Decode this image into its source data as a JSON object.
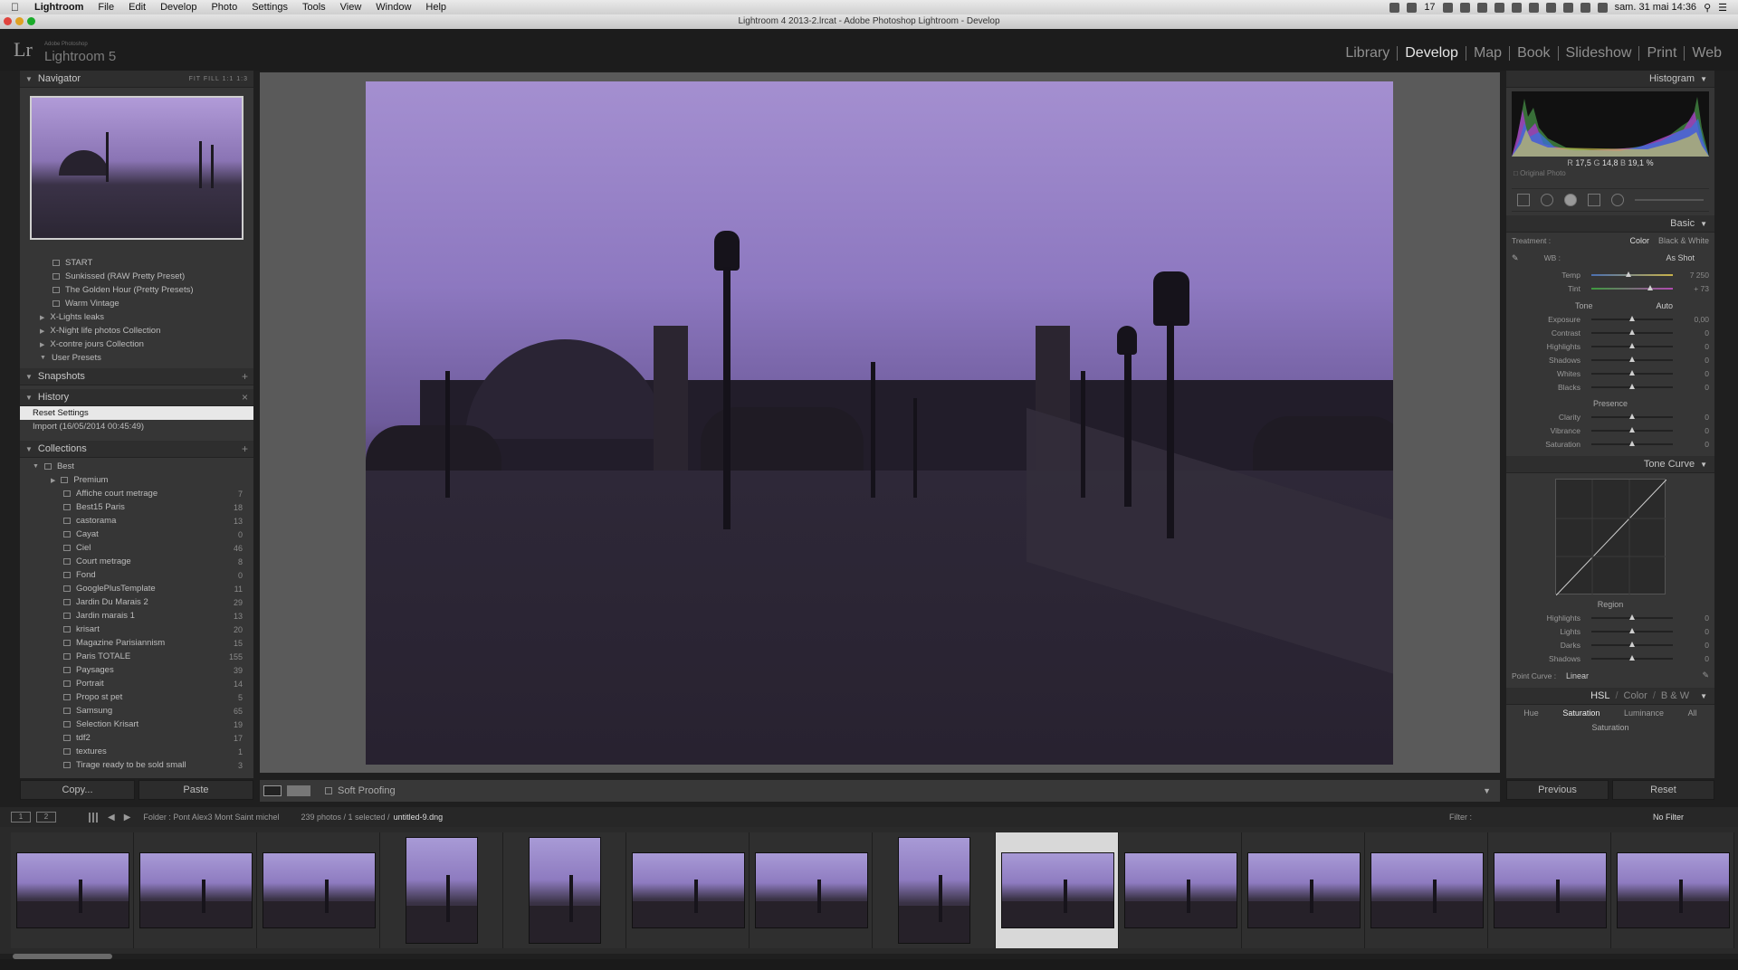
{
  "menubar": {
    "app": "Lightroom",
    "items": [
      "File",
      "Edit",
      "Develop",
      "Photo",
      "Settings",
      "Tools",
      "View",
      "Window",
      "Help"
    ],
    "status": "17",
    "clock": "sam. 31 mai  14:36"
  },
  "window": {
    "title": "Lightroom 4 2013-2.lrcat - Adobe Photoshop Lightroom - Develop"
  },
  "identity": {
    "brand": "Adobe Photoshop",
    "product": "Lightroom 5"
  },
  "modules": [
    "Library",
    "Develop",
    "Map",
    "Book",
    "Slideshow",
    "Print",
    "Web"
  ],
  "left": {
    "navigator": {
      "title": "Navigator",
      "opts": "FIT  FILL  1:1  1:3"
    },
    "presets": [
      {
        "label": "START",
        "indent": 2
      },
      {
        "label": "Sunkissed (RAW Pretty Preset)",
        "indent": 2
      },
      {
        "label": "The Golden Hour (Pretty Presets)",
        "indent": 2
      },
      {
        "label": "Warm Vintage",
        "indent": 2
      },
      {
        "label": "X-Lights leaks",
        "indent": 1
      },
      {
        "label": "X-Night life  photos Collection",
        "indent": 1
      },
      {
        "label": "X-contre jours Collection",
        "indent": 1
      },
      {
        "label": "User Presets",
        "indent": 1
      }
    ],
    "snapshots": {
      "title": "Snapshots"
    },
    "history": {
      "title": "History",
      "items": [
        "Reset Settings",
        "Import (16/05/2014 00:45:49)"
      ]
    },
    "collections": {
      "title": "Collections",
      "root": "Best",
      "items": [
        {
          "label": "Premium",
          "count": ""
        },
        {
          "label": "Affiche court metrage",
          "count": "7"
        },
        {
          "label": "Best15 Paris",
          "count": "18"
        },
        {
          "label": "castorama",
          "count": "13"
        },
        {
          "label": "Cayat",
          "count": "0"
        },
        {
          "label": "Ciel",
          "count": "46"
        },
        {
          "label": "Court metrage",
          "count": "8"
        },
        {
          "label": "Fond",
          "count": "0"
        },
        {
          "label": "GooglePlusTemplate",
          "count": "11"
        },
        {
          "label": "Jardin Du Marais 2",
          "count": "29"
        },
        {
          "label": "Jardin marais 1",
          "count": "13"
        },
        {
          "label": "krisart",
          "count": "20"
        },
        {
          "label": "Magazine Parisiannism",
          "count": "15"
        },
        {
          "label": "Paris TOTALE",
          "count": "155"
        },
        {
          "label": "Paysages",
          "count": "39"
        },
        {
          "label": "Portrait",
          "count": "14"
        },
        {
          "label": "Propo st pet",
          "count": "5"
        },
        {
          "label": "Samsung",
          "count": "65"
        },
        {
          "label": "Selection Krisart",
          "count": "19"
        },
        {
          "label": "tdf2",
          "count": "17"
        },
        {
          "label": "textures",
          "count": "1"
        },
        {
          "label": "Tirage ready to be sold small",
          "count": "3"
        }
      ]
    },
    "buttons": {
      "copy": "Copy...",
      "paste": "Paste"
    }
  },
  "center": {
    "soft_proofing": "Soft Proofing"
  },
  "right": {
    "histogram": {
      "title": "Histogram",
      "r_label": "R",
      "r": "17,5",
      "g_label": "G",
      "g": "14,8",
      "b_label": "B",
      "b": "19,1",
      "pct": "%",
      "original": "Original Photo"
    },
    "basic": {
      "title": "Basic",
      "treatment_label": "Treatment :",
      "color": "Color",
      "bw": "Black & White",
      "wb_label": "WB :",
      "wb_value": "As Shot",
      "wb_sliders": [
        {
          "label": "Temp",
          "value": "7 250",
          "pos": 0.46
        },
        {
          "label": "Tint",
          "value": "+ 73",
          "pos": 0.72
        }
      ],
      "tone_label": "Tone",
      "auto": "Auto",
      "tone_sliders": [
        {
          "label": "Exposure",
          "value": "0,00",
          "pos": 0.5
        },
        {
          "label": "Contrast",
          "value": "0",
          "pos": 0.5
        },
        {
          "label": "Highlights",
          "value": "0",
          "pos": 0.5
        },
        {
          "label": "Shadows",
          "value": "0",
          "pos": 0.5
        },
        {
          "label": "Whites",
          "value": "0",
          "pos": 0.5
        },
        {
          "label": "Blacks",
          "value": "0",
          "pos": 0.5
        }
      ],
      "presence_label": "Presence",
      "presence_sliders": [
        {
          "label": "Clarity",
          "value": "0",
          "pos": 0.5
        },
        {
          "label": "Vibrance",
          "value": "0",
          "pos": 0.5
        },
        {
          "label": "Saturation",
          "value": "0",
          "pos": 0.5
        }
      ]
    },
    "tone_curve": {
      "title": "Tone Curve",
      "region_label": "Region",
      "sliders": [
        {
          "label": "Highlights",
          "value": "0",
          "pos": 0.5
        },
        {
          "label": "Lights",
          "value": "0",
          "pos": 0.5
        },
        {
          "label": "Darks",
          "value": "0",
          "pos": 0.5
        },
        {
          "label": "Shadows",
          "value": "0",
          "pos": 0.5
        }
      ],
      "point_curve_label": "Point Curve :",
      "point_curve_value": "Linear"
    },
    "hsl": {
      "hsl": "HSL",
      "color": "Color",
      "bw": "B & W",
      "tabs": [
        "Hue",
        "Saturation",
        "Luminance",
        "All"
      ],
      "section": "Saturation"
    },
    "buttons": {
      "previous": "Previous",
      "reset": "Reset"
    }
  },
  "filmbar": {
    "folder": "Folder : Pont Alex3 Mont Saint michel",
    "count": "239 photos / 1 selected /",
    "file": "untitled-9.dng",
    "filter_label": "Filter :",
    "filter_value": "No Filter",
    "page1": "1",
    "page2": "2"
  },
  "filmstrip": {
    "thumbs": [
      {
        "w": 125,
        "h": 84,
        "sel": false
      },
      {
        "w": 125,
        "h": 84,
        "sel": false
      },
      {
        "w": 125,
        "h": 84,
        "sel": false
      },
      {
        "w": 80,
        "h": 118,
        "sel": false
      },
      {
        "w": 80,
        "h": 118,
        "sel": false
      },
      {
        "w": 125,
        "h": 84,
        "sel": false
      },
      {
        "w": 125,
        "h": 84,
        "sel": false
      },
      {
        "w": 80,
        "h": 118,
        "sel": false
      },
      {
        "w": 125,
        "h": 84,
        "sel": true
      },
      {
        "w": 125,
        "h": 84,
        "sel": false
      },
      {
        "w": 125,
        "h": 84,
        "sel": false
      },
      {
        "w": 125,
        "h": 84,
        "sel": false
      },
      {
        "w": 125,
        "h": 84,
        "sel": false
      },
      {
        "w": 125,
        "h": 84,
        "sel": false
      }
    ]
  }
}
